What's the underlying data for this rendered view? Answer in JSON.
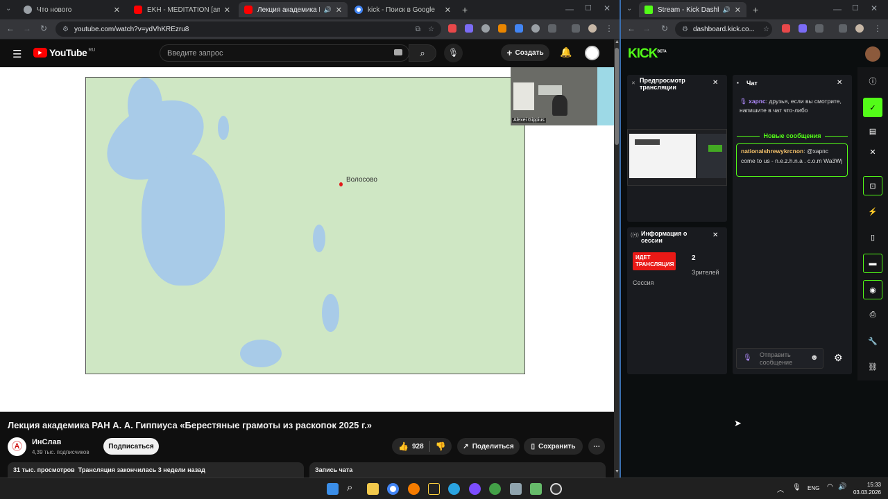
{
  "left_browser": {
    "tabs": [
      {
        "title": "Что нового",
        "favicon_color": "#9aa0a6"
      },
      {
        "title": "EKH - MEDITATION [ambient] -",
        "favicon_color": "#ff0000"
      },
      {
        "title": "Лекция академика РАН А.",
        "favicon_color": "#ff0000"
      },
      {
        "title": "kick - Поиск в Google",
        "favicon_color": "#4285f4"
      }
    ],
    "new_tab": "+",
    "url": "youtube.com/watch?v=ydVhKREzru8"
  },
  "youtube": {
    "logo": "YouTube",
    "region": "RU",
    "search_placeholder": "Введите запрос",
    "create_label": "Создать",
    "map_label": "Волосово",
    "camera_caption": "Alexei Gippius",
    "video_title": "Лекция академика РАН А. А. Гиппиуса «Берестяные грамоты из раскопок 2025 г.»",
    "channel_name": "ИнСлав",
    "subscribers": "4,39 тыс. подписчиков",
    "subscribe_label": "Подписаться",
    "likes": "928",
    "share_label": "Поделиться",
    "save_label": "Сохранить",
    "views_line": "31 тыс. просмотров  Трансляция закончилась 3 недели назад",
    "chat_replay": "Запись чата"
  },
  "right_browser": {
    "tab_title": "Stream - Kick Dashboard",
    "url": "dashboard.kick.co...",
    "new_tab": "+"
  },
  "kick": {
    "logo": "KICK",
    "logo_badge": "BETA",
    "preview_title": "Предпросмотр трансляции",
    "session_title": "Информация о сессии",
    "live_badge": "ИДЕТ ТРАНСЛЯЦИЯ",
    "session_label": "Сессия",
    "viewers_count": "2",
    "viewers_label": "Зрителей",
    "chat_title": "Чат",
    "messages": [
      {
        "user": "харпс",
        "text": ": друзья, если вы смотрите, напишите в чат что-либо",
        "user_color": "#b18cff"
      },
      {
        "user": "nationalshrewykrcnon",
        "text": ": @харпс come to us - n.e.z.h.n.a . c.o.m Wa3Wj",
        "user_color": "#f5c26b"
      }
    ],
    "new_messages_label": "Новые сообщения",
    "send_placeholder": "Отправить сообщение",
    "accent": "#53fc18",
    "live_color": "#e91916"
  },
  "taskbar": {
    "lang": "ENG",
    "time": "15:33",
    "date": "03.03.2026"
  }
}
